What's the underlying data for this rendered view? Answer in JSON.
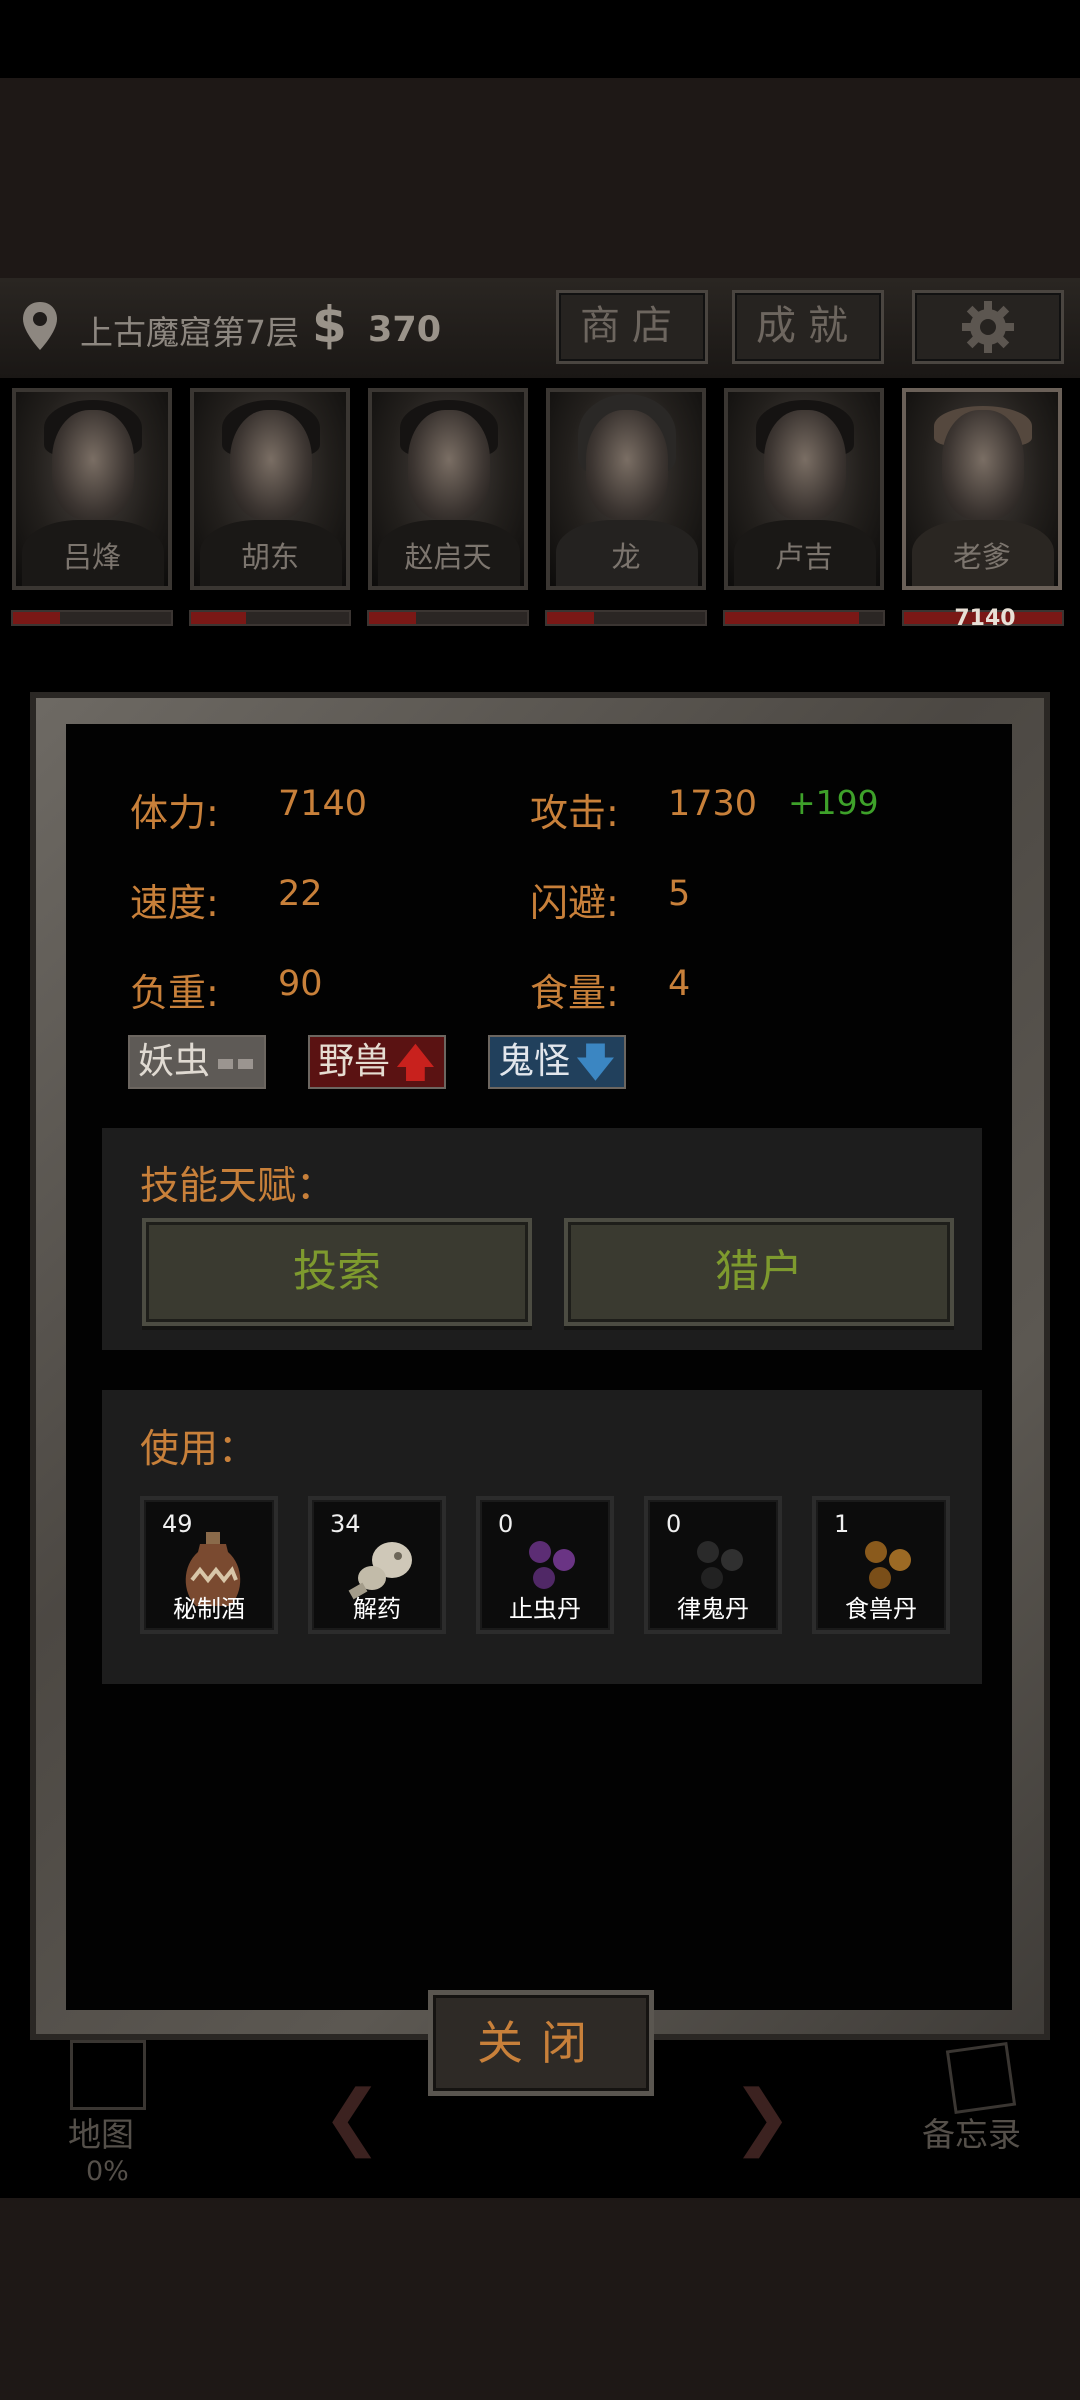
{
  "header": {
    "location": "上古魔窟第7层",
    "currency_symbol": "$",
    "coins": "370",
    "shop_label": "商店",
    "achievements_label": "成就",
    "settings_icon": "gear-icon"
  },
  "characters": [
    {
      "name": "吕烽",
      "hp_fraction": 0.3
    },
    {
      "name": "胡东",
      "hp_fraction": 0.35
    },
    {
      "name": "赵启天",
      "hp_fraction": 0.3
    },
    {
      "name": "龙",
      "hp_fraction": 0.3
    },
    {
      "name": "卢吉",
      "hp_fraction": 0.85
    },
    {
      "name": "老爹",
      "hp_fraction": 1.0,
      "hp_text": "7140",
      "selected": true
    }
  ],
  "stats": {
    "stamina_label": "体力:",
    "stamina": "7140",
    "attack_label": "攻击:",
    "attack": "1730",
    "attack_bonus": "+199",
    "speed_label": "速度:",
    "speed": "22",
    "dodge_label": "闪避:",
    "dodge": "5",
    "load_label": "负重:",
    "load": "90",
    "food_label": "食量:",
    "food": "4"
  },
  "tags": [
    {
      "label": "妖虫",
      "indicator": "neutral"
    },
    {
      "label": "野兽",
      "indicator": "up"
    },
    {
      "label": "鬼怪",
      "indicator": "down"
    }
  ],
  "skills": {
    "title": "技能天赋：",
    "items": [
      "投索",
      "猎户"
    ]
  },
  "use": {
    "title": "使用：",
    "items": [
      {
        "count": "49",
        "label": "秘制酒",
        "icon": "wine-jar-icon"
      },
      {
        "count": "34",
        "label": "解药",
        "icon": "gourd-icon"
      },
      {
        "count": "0",
        "label": "止虫丹",
        "icon": "purple-pills-icon"
      },
      {
        "count": "0",
        "label": "律鬼丹",
        "icon": "black-pills-icon"
      },
      {
        "count": "1",
        "label": "食兽丹",
        "icon": "brown-pills-icon"
      }
    ]
  },
  "close_label": "关闭",
  "bottom_nav": {
    "map_label": "地图",
    "map_progress": "0%",
    "memo_label": "备忘录"
  }
}
